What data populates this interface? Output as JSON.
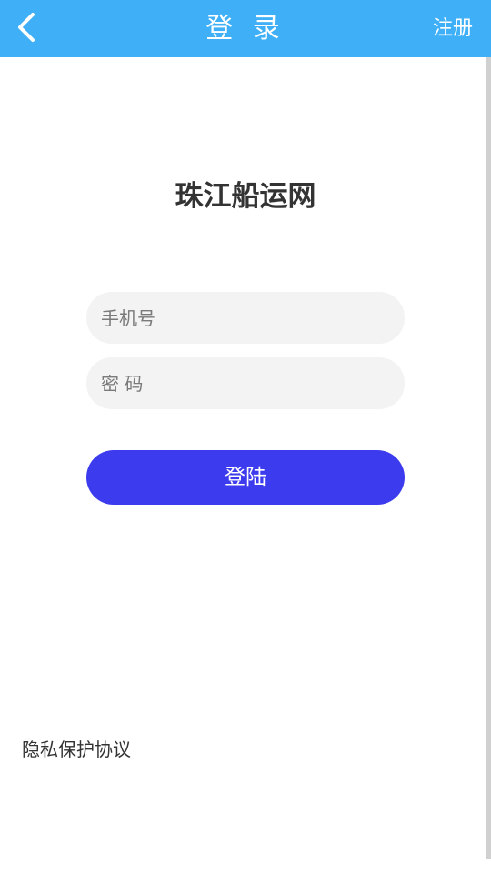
{
  "header": {
    "title": "登 录",
    "register_label": "注册",
    "back_icon": "chevron-left-icon",
    "background_color": "#3fb0f7"
  },
  "app": {
    "name": "珠江船运网"
  },
  "form": {
    "phone_placeholder": "手机号",
    "phone_value": "",
    "password_placeholder": "密 码",
    "password_value": "",
    "login_label": "登陆",
    "login_color": "#3d3bee"
  },
  "footer": {
    "privacy_label": "隐私保护协议"
  }
}
